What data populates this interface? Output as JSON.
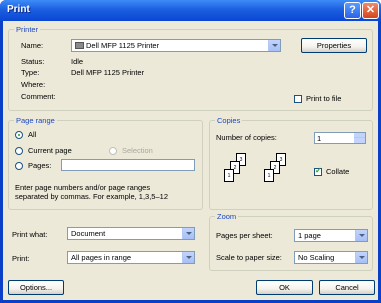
{
  "window": {
    "title": "Print",
    "help_glyph": "?",
    "close_glyph": "✕"
  },
  "printer": {
    "group_title": "Printer",
    "name_label": "Name:",
    "name_value": "Dell MFP 1125 Printer",
    "properties_label": "Properties",
    "status_label": "Status:",
    "status_value": "Idle",
    "type_label": "Type:",
    "type_value": "Dell MFP 1125 Printer",
    "where_label": "Where:",
    "where_value": "",
    "comment_label": "Comment:",
    "comment_value": "",
    "print_to_file_label": "Print to file",
    "print_to_file_checked": false
  },
  "page_range": {
    "group_title": "Page range",
    "all_label": "All",
    "current_page_label": "Current page",
    "selection_label": "Selection",
    "pages_label": "Pages:",
    "pages_value": "",
    "help_text_line1": "Enter page numbers and/or page ranges",
    "help_text_line2": "separated by commas.  For example, 1,3,5–12",
    "selected": "all"
  },
  "copies": {
    "group_title": "Copies",
    "number_label": "Number of copies:",
    "number_value": "1",
    "collate_label": "Collate",
    "collate_checked": true,
    "page_labels": [
      "3",
      "2",
      "1",
      "3",
      "2",
      "1"
    ]
  },
  "print_what": {
    "label": "Print what:",
    "value": "Document"
  },
  "print": {
    "label": "Print:",
    "value": "All pages in range"
  },
  "zoom": {
    "group_title": "Zoom",
    "pages_per_sheet_label": "Pages per sheet:",
    "pages_per_sheet_value": "1 page",
    "scale_label": "Scale to paper size:",
    "scale_value": "No Scaling"
  },
  "buttons": {
    "options": "Options...",
    "ok": "OK",
    "cancel": "Cancel"
  }
}
